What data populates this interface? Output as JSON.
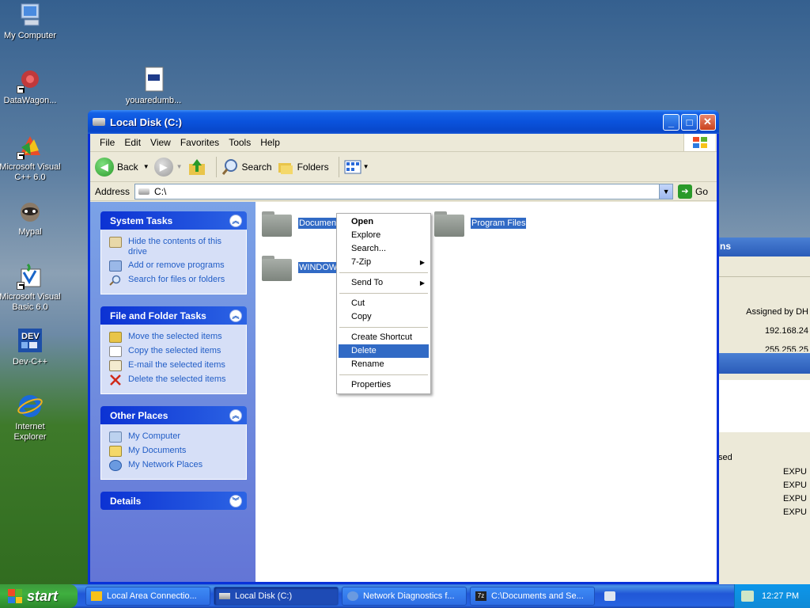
{
  "desktop": {
    "icons": [
      {
        "label": "My Computer"
      },
      {
        "label": "DataWagon..."
      },
      {
        "label": "youaredumb..."
      },
      {
        "label": "Microsoft Visual C++ 6.0"
      },
      {
        "label": "Mypal"
      },
      {
        "label": "Microsoft Visual Basic 6.0"
      },
      {
        "label": "Dev-C++"
      },
      {
        "label": "Internet Explorer"
      }
    ]
  },
  "background_window": {
    "title_fragment": "ns",
    "assigned": "Assigned by DH",
    "ip": "192.168.24",
    "mask": "255.255.25",
    "col_fragment": "sed",
    "rows": [
      "EXPU",
      "EXPU",
      "EXPU",
      "EXPU"
    ]
  },
  "window": {
    "title": "Local Disk (C:)",
    "menu": [
      "File",
      "Edit",
      "View",
      "Favorites",
      "Tools",
      "Help"
    ],
    "toolbar": {
      "back": "Back",
      "search": "Search",
      "folders": "Folders"
    },
    "address": {
      "label": "Address",
      "value": "C:\\",
      "go": "Go"
    }
  },
  "tasks_pane": {
    "system_tasks": {
      "title": "System Tasks",
      "items": [
        "Hide the contents of this drive",
        "Add or remove programs",
        "Search for files or folders"
      ]
    },
    "file_folder_tasks": {
      "title": "File and Folder Tasks",
      "items": [
        "Move the selected items",
        "Copy the selected items",
        "E-mail the selected items",
        "Delete the selected items"
      ]
    },
    "other_places": {
      "title": "Other Places",
      "items": [
        "My Computer",
        "My Documents",
        "My Network Places"
      ]
    },
    "details": {
      "title": "Details"
    }
  },
  "files": [
    {
      "label": "Documen"
    },
    {
      "label": "Program Files"
    },
    {
      "label": "WINDOW"
    }
  ],
  "context_menu": {
    "items": [
      "Open",
      "Explore",
      "Search...",
      "7-Zip",
      "Send To",
      "Cut",
      "Copy",
      "Create Shortcut",
      "Delete",
      "Rename",
      "Properties"
    ],
    "highlighted": "Delete"
  },
  "taskbar": {
    "start": "start",
    "tasks": [
      "Local Area Connectio...",
      "Local Disk (C:)",
      "Network Diagnostics f...",
      "C:\\Documents and Se..."
    ],
    "active": "Local Disk (C:)",
    "clock": "12:27 PM"
  },
  "colors": {
    "accent": "#316ac5",
    "title_blue": "#0a52dc",
    "task_link": "#215dc6"
  }
}
